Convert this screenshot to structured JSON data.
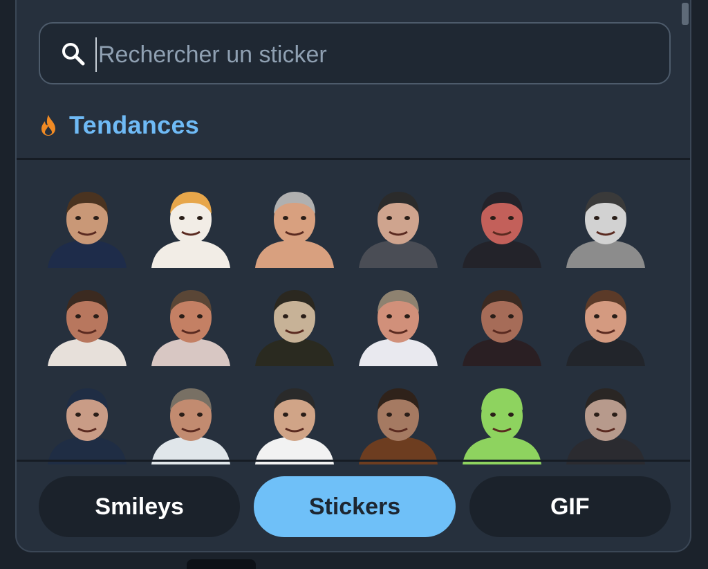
{
  "search": {
    "placeholder": "Rechercher un sticker",
    "value": ""
  },
  "section": {
    "title": "Tendances",
    "icon": "fire-icon"
  },
  "stickers": [
    {
      "name": "sticker-man-pointing-jersey",
      "skin": "#c99877",
      "shirt": "#1e2c4a",
      "hair": "#4a3320"
    },
    {
      "name": "sticker-dog-french-flag",
      "skin": "#f2ede6",
      "shirt": "#f2ede6",
      "hair": "#e7a64a"
    },
    {
      "name": "sticker-shirtless-man",
      "skin": "#d8a07f",
      "shirt": "#d8a07f",
      "hair": "#b0b0b0"
    },
    {
      "name": "sticker-officer-cap",
      "skin": "#cfa48e",
      "shirt": "#4a4d55",
      "hair": "#2b2b2b"
    },
    {
      "name": "sticker-raised-arm",
      "skin": "#c3605a",
      "shirt": "#23232a",
      "hair": "#23232a"
    },
    {
      "name": "sticker-man-heart-hands",
      "skin": "#d2d2d2",
      "shirt": "#8c8c8c",
      "hair": "#3a3a3a"
    },
    {
      "name": "sticker-laughing-mustache-man",
      "skin": "#b8775e",
      "shirt": "#e7e0da",
      "hair": "#3b2a20"
    },
    {
      "name": "sticker-laughing-man-closeup",
      "skin": "#c48064",
      "shirt": "#d8c7c3",
      "hair": "#5a4636"
    },
    {
      "name": "sticker-curly-hair-man",
      "skin": "#c7b297",
      "shirt": "#2a2a20",
      "hair": "#2b2820"
    },
    {
      "name": "sticker-man-big-glasses",
      "skin": "#d1907a",
      "shirt": "#e9e9ef",
      "hair": "#8e8270"
    },
    {
      "name": "sticker-man-with-notepad",
      "skin": "#a66c58",
      "shirt": "#2a1f23",
      "hair": "#3a2a22"
    },
    {
      "name": "sticker-man-red-glasses",
      "skin": "#d49a80",
      "shirt": "#22252b",
      "hair": "#5b3a28"
    },
    {
      "name": "sticker-beanie-facepalm",
      "skin": "#c99c86",
      "shirt": "#1f2d44",
      "hair": "#1f2d44"
    },
    {
      "name": "sticker-small-mustache-man",
      "skin": "#c28b70",
      "shirt": "#e0e6ea",
      "hair": "#787064"
    },
    {
      "name": "sticker-shouting-man",
      "skin": "#d0a487",
      "shirt": "#f2f2f2",
      "hair": "#2a2a2a"
    },
    {
      "name": "sticker-man-hands-on-face",
      "skin": "#a57a62",
      "shirt": "#6d3d20",
      "hair": "#2f221a"
    },
    {
      "name": "sticker-green-alien-cat",
      "skin": "#8ed35f",
      "shirt": "#8ed35f",
      "hair": "#8ed35f"
    },
    {
      "name": "sticker-smiling-man-dark",
      "skin": "#b79a8c",
      "shirt": "#2b2b30",
      "hair": "#2a2624"
    }
  ],
  "tabs": [
    {
      "label": "Smileys",
      "active": false
    },
    {
      "label": "Stickers",
      "active": true
    },
    {
      "label": "GIF",
      "active": false
    }
  ],
  "colors": {
    "accent": "#6fc0f8",
    "section_title": "#6fbaf5",
    "fire": "#f08a24"
  }
}
